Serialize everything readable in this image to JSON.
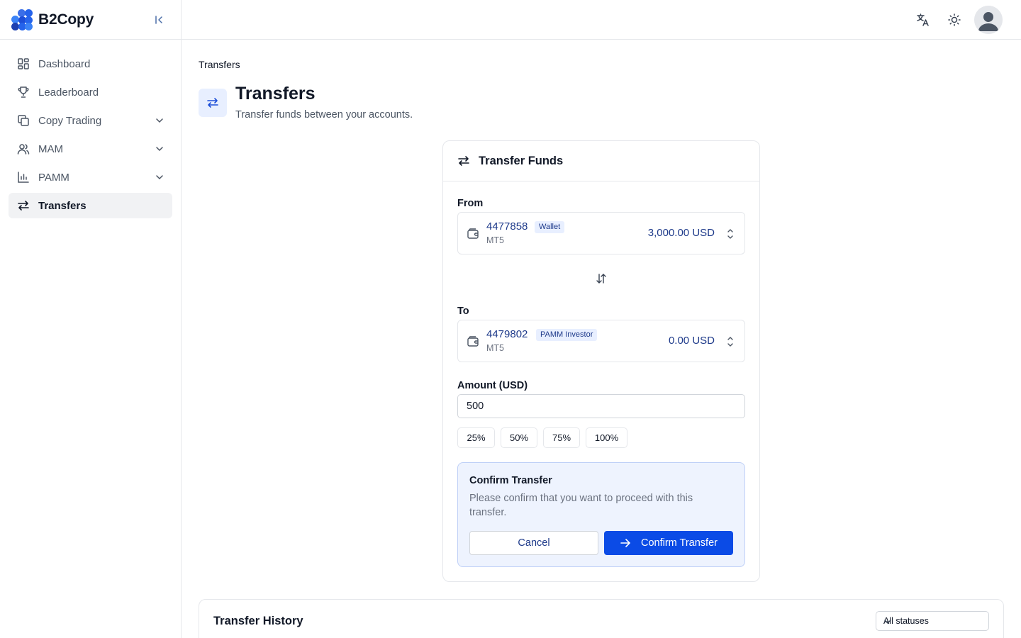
{
  "brand": {
    "name": "B2Copy"
  },
  "sidebar": {
    "items": [
      {
        "label": "Dashboard",
        "icon": "dashboard-icon"
      },
      {
        "label": "Leaderboard",
        "icon": "trophy-icon"
      },
      {
        "label": "Copy Trading",
        "icon": "copy-icon",
        "expandable": true
      },
      {
        "label": "MAM",
        "icon": "users-icon",
        "expandable": true
      },
      {
        "label": "PAMM",
        "icon": "bar-chart-icon",
        "expandable": true
      },
      {
        "label": "Transfers",
        "icon": "arrows-left-right-icon",
        "active": true
      }
    ]
  },
  "topbar": {
    "icons": [
      "translate-icon",
      "sun-icon",
      "user-avatar"
    ]
  },
  "page": {
    "breadcrumb": "Transfers",
    "title": "Transfers",
    "subtitle": "Transfer funds between your accounts."
  },
  "transfer_card": {
    "title": "Transfer Funds",
    "from_label": "From",
    "from": {
      "account": "4477858",
      "badge": "Wallet",
      "platform": "MT5",
      "balance": "3,000.00 USD"
    },
    "to_label": "To",
    "to": {
      "account": "4479802",
      "badge": "PAMM Investor",
      "platform": "MT5",
      "balance": "0.00 USD"
    },
    "amount_label": "Amount (USD)",
    "amount_value": "500",
    "percent_buttons": [
      "25%",
      "50%",
      "75%",
      "100%"
    ],
    "confirm": {
      "title": "Confirm Transfer",
      "text": "Please confirm that you want to proceed with this transfer.",
      "cancel_label": "Cancel",
      "confirm_label": "Confirm Transfer"
    }
  },
  "history": {
    "title": "Transfer History",
    "status_filter": "All statuses"
  },
  "colors": {
    "accent": "#0b4be6",
    "accent_light": "#e8efff",
    "text_dark_blue": "#1e3a8a",
    "brand": "#2563eb"
  }
}
